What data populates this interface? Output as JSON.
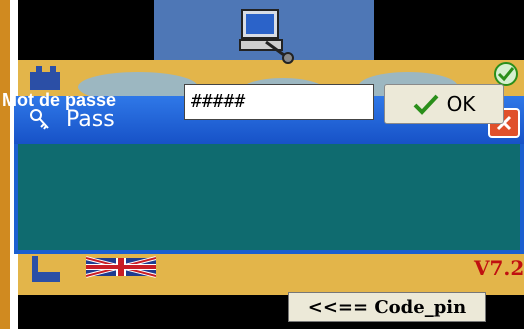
{
  "dialog": {
    "title": "Pass",
    "password_label": "Mot de passe",
    "password_value": "#####",
    "ok_label": "OK"
  },
  "background": {
    "version_text": "V7.2",
    "code_pin_label": "<<== Code_pin"
  },
  "icons": [
    "computer-icon",
    "key-icon",
    "close-icon",
    "check-icon",
    "tool-icon",
    "flag-icon"
  ],
  "colors": {
    "titlebar": "#1f5fd6",
    "dialog_body": "#0f6b6f",
    "close_button": "#e0502b",
    "ok_check": "#2a8f1a",
    "background_gold": "#e3b54a",
    "background_blue": "#4e77b6",
    "version_red": "#c01010"
  }
}
